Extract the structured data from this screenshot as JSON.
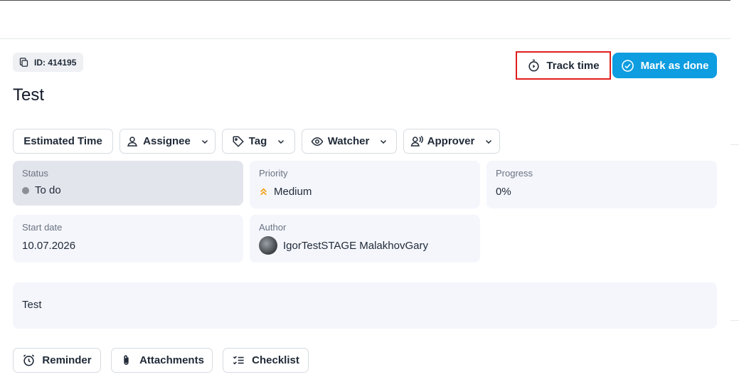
{
  "header": {
    "id_label": "ID: 414195",
    "title": "Test"
  },
  "actions": {
    "track_time": "Track time",
    "mark_done": "Mark as done"
  },
  "fields_toolbar": [
    {
      "label": "Estimated Time",
      "icon": "none"
    },
    {
      "label": "Assignee",
      "icon": "user-icon"
    },
    {
      "label": "Tag",
      "icon": "tag-icon"
    },
    {
      "label": "Watcher",
      "icon": "eye-icon"
    },
    {
      "label": "Approver",
      "icon": "approver-icon"
    }
  ],
  "details": {
    "status": {
      "label": "Status",
      "value": "To do"
    },
    "priority": {
      "label": "Priority",
      "value": "Medium"
    },
    "progress": {
      "label": "Progress",
      "value": "0%"
    },
    "start_date": {
      "label": "Start date",
      "value": "10.07.2026"
    },
    "author": {
      "label": "Author",
      "value": "IgorTestSTAGE MalakhovGary"
    }
  },
  "description": "Test",
  "bottom_actions": {
    "reminder": "Reminder",
    "attachments": "Attachments",
    "checklist": "Checklist"
  },
  "colors": {
    "accent": "#0d9de0",
    "highlight_border": "#e11d1d",
    "priority_icon": "#f59e0b",
    "card_bg": "#f4f6fc"
  }
}
